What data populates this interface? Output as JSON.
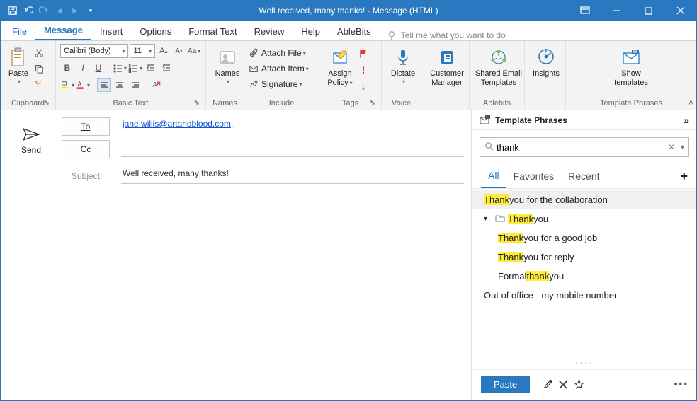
{
  "window": {
    "title": "Well received, many thanks!  -  Message (HTML)"
  },
  "menu": {
    "tabs": [
      "File",
      "Message",
      "Insert",
      "Options",
      "Format Text",
      "Review",
      "Help",
      "AbleBits"
    ],
    "active": "Message",
    "tellme": "Tell me what you want to do"
  },
  "ribbon": {
    "clipboard": {
      "label": "Clipboard",
      "paste": "Paste"
    },
    "basictext": {
      "label": "Basic Text",
      "font": "Calibri (Body)",
      "size": "11"
    },
    "names": {
      "label": "Names",
      "btn": "Names"
    },
    "include": {
      "label": "Include",
      "attach_file": "Attach File",
      "attach_item": "Attach Item",
      "signature": "Signature"
    },
    "tags": {
      "label": "Tags",
      "assign": "Assign",
      "policy": "Policy"
    },
    "voice": {
      "label": "Voice",
      "dictate": "Dictate"
    },
    "customer": {
      "line1": "Customer",
      "line2": "Manager"
    },
    "ablebits": {
      "label": "Ablebits",
      "line1": "Shared Email",
      "line2": "Templates"
    },
    "insights": {
      "btn": "Insights"
    },
    "tplphrases": {
      "label": "Template Phrases",
      "line1": "Show",
      "line2": "templates"
    }
  },
  "compose": {
    "send": "Send",
    "to_label": "To",
    "to_value": "jane.willis@artandblood.com;",
    "cc_label": "Cc",
    "cc_value": "",
    "subject_label": "Subject",
    "subject_value": "Well received, many thanks!"
  },
  "sidepanel": {
    "title": "Template Phrases",
    "search": "thank",
    "tabs": {
      "all": "All",
      "fav": "Favorites",
      "recent": "Recent"
    },
    "items": [
      {
        "kind": "template",
        "pre": "Thank",
        "post": " you for the collaboration",
        "indent": 0,
        "sel": true
      },
      {
        "kind": "folder",
        "pre": "Thank",
        "post": " you",
        "indent": 0
      },
      {
        "kind": "template",
        "pre": "Thank",
        "post": " you for a good job",
        "indent": 1
      },
      {
        "kind": "template",
        "pre": "Thank",
        "post": " you for reply",
        "indent": 1
      },
      {
        "kind": "template",
        "pre2_a": "Formal ",
        "pre2_b": "thank",
        "pre2_c": " you",
        "indent": 1
      },
      {
        "kind": "plain",
        "text": "Out of office - my mobile number",
        "indent": 0
      }
    ],
    "paste": "Paste"
  }
}
